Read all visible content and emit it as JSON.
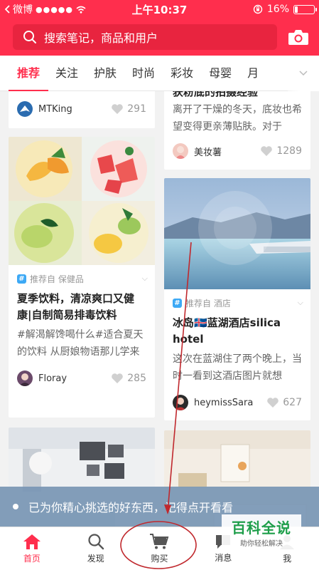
{
  "status_bar": {
    "carrier": "微博",
    "time": "上午10:37",
    "battery": "16%",
    "battery_level": 0.16
  },
  "search": {
    "placeholder": "搜索笔记，商品和用户",
    "search_icon": "search-icon",
    "camera_icon": "camera-icon"
  },
  "tabs": [
    "推荐",
    "关注",
    "护肤",
    "时尚",
    "彩妆",
    "母婴",
    "月"
  ],
  "active_tab": "推荐",
  "cards": {
    "top_left": {
      "author": "MTKing",
      "likes": "291"
    },
    "top_right": {
      "title_partial": "获粉底的拍摄经验",
      "desc": "离开了干燥的冬天，底妆也希望变得更亲薄贴肤。对于",
      "author": "美妆薯",
      "likes": "1289"
    },
    "mid_left": {
      "tag": "推荐自 保健品",
      "title": "夏季饮料，清凉爽口又健康|自制简易排毒饮料",
      "desc": "#解渴解馋喝什么#适合夏天的饮料 从厨娘物语那儿学来",
      "author": "Floray",
      "likes": "285"
    },
    "mid_right": {
      "tag": "推荐自 酒店",
      "title": "冰岛🇮🇸蓝湖酒店silica hotel",
      "desc": "这次在蓝湖住了两个晚上，当时一看到这酒店图片就想",
      "author": "heymissSara",
      "likes": "627"
    }
  },
  "toast": {
    "text": "已为你精心挑选的好东西，记得点开看看"
  },
  "tabbar": [
    {
      "label": "首页",
      "icon": "home-icon"
    },
    {
      "label": "发现",
      "icon": "discover-search-icon"
    },
    {
      "label": "购买",
      "icon": "shopping-cart-icon"
    },
    {
      "label": "消息",
      "icon": "message-icon"
    },
    {
      "label": "我",
      "icon": "profile-icon"
    }
  ],
  "watermark": {
    "main": "百科全说",
    "sub": "助你轻松解决"
  },
  "colors": {
    "brand": "#ff2e4d",
    "annotation": "#c0282d"
  }
}
